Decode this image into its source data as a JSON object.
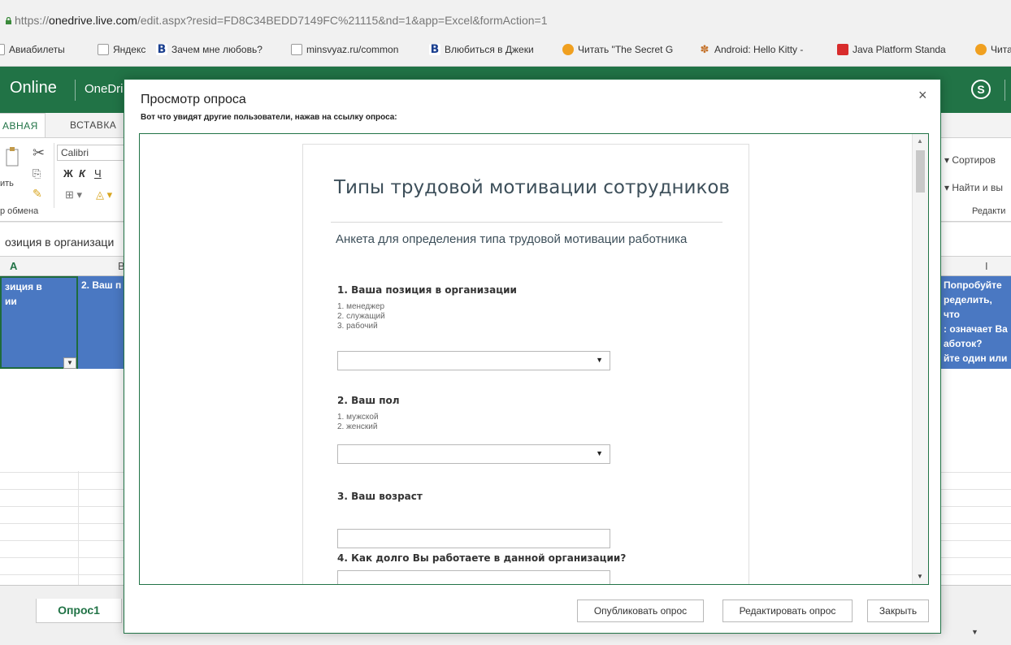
{
  "browser": {
    "url_scheme": "https://",
    "url_host": "onedrive.live.com",
    "url_path": "/edit.aspx?resid=FD8C34BEDD7149FC%21115&nd=1&app=Excel&formAction=1",
    "bookmarks": [
      {
        "label": "Авиабилеты",
        "icon": "document-icon"
      },
      {
        "label": "Яндекс",
        "icon": "document-icon"
      },
      {
        "label": "Зачем мне любовь?",
        "icon": "b-logo-icon"
      },
      {
        "label": "minsvyaz.ru/common",
        "icon": "document-icon"
      },
      {
        "label": "Влюбиться в Джеки",
        "icon": "b-logo-icon"
      },
      {
        "label": "Читать \"The Secret G",
        "icon": "orange-circle-icon"
      },
      {
        "label": "Android: Hello Kitty -",
        "icon": "paw-icon"
      },
      {
        "label": "Java Platform Standa",
        "icon": "red-square-icon"
      },
      {
        "label": "Чита",
        "icon": "orange-circle-icon"
      }
    ]
  },
  "app": {
    "brand": "Online",
    "service": "OneDri",
    "skype_icon": "S"
  },
  "ribbon": {
    "tabs": [
      "АВНАЯ",
      "ВСТАВКА"
    ],
    "font_name": "Calibri",
    "format_buttons": [
      "Ж",
      "К",
      "Ч"
    ],
    "clipboard_label": "ить",
    "clipboard_group": "р обмена",
    "sort_label": "Сортиров",
    "find_label": "Найти и вы",
    "edit_group": "Редакти"
  },
  "sheet": {
    "name_box": "озиция в организаци",
    "col_a": "A",
    "col_b": "B",
    "col_i": "I",
    "cell_a1": "зиция в\nии",
    "cell_b1": "2. Ваш п",
    "cell_i1": "Попробуйте\nределить, что\n: означает Ва\nаботок?\nйте один или\nант",
    "tab": "Опрос1"
  },
  "dialog": {
    "title": "Просмотр опроса",
    "subtitle": "Вот что увидят другие пользователи, нажав на ссылку опроса:",
    "close": "×",
    "buttons": {
      "publish": "Опубликовать опрос",
      "edit": "Редактировать опрос",
      "close": "Закрыть"
    }
  },
  "form": {
    "title": "Типы трудовой мотивации сотрудников",
    "description": "Анкета для определения типа трудовой мотивации работника",
    "q1": {
      "title": "1. Ваша позиция в организации",
      "options": [
        "1. менеджер",
        "2. служащий",
        "3. рабочий"
      ],
      "value": ""
    },
    "q2": {
      "title": "2. Ваш пол",
      "options": [
        "1. мужской",
        "2. женский"
      ],
      "value": ""
    },
    "q3": {
      "title": "3. Ваш возраст",
      "value": ""
    },
    "q4": {
      "title": "4. Как долго Вы работаете в данной организации?",
      "value": ""
    }
  }
}
